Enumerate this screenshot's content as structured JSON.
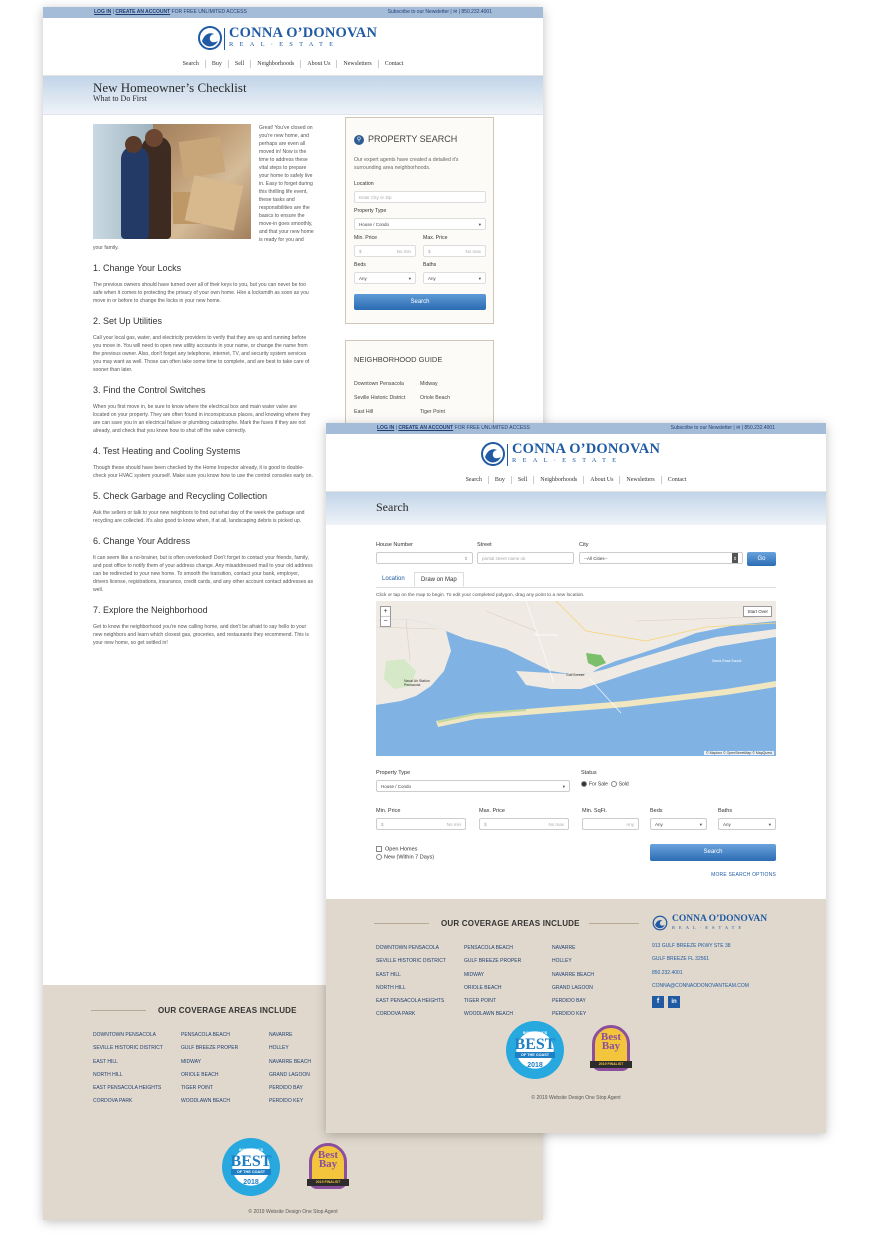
{
  "page1": {
    "topbar": {
      "login": "LOG IN",
      "sep": "|",
      "create": "CREATE AN ACCOUNT",
      "free": "FOR FREE UNLIMITED ACCESS",
      "subscribe": "Subscribe to our Newsletter",
      "phone": "850.232.4001"
    },
    "logo": {
      "name": "CONNA O’DONOVAN",
      "sub": "REAL·ESTATE"
    },
    "nav": [
      "Search",
      "Buy",
      "Sell",
      "Neighborhoods",
      "About Us",
      "Newsletters",
      "Contact"
    ],
    "hero": {
      "title": "New Homeowner’s Checklist",
      "subtitle": "What to Do First"
    },
    "intro": "Great! You've closed on you're new home, and perhaps are even all moved in! Now is the time to address these vital steps to prepare your home to safely live in. Easy to forget during this thrilling life event, these tasks and responsibilities are the basics to ensure the move-in goes smoothly, and that your new home is ready for you and your family.",
    "sections": [
      {
        "heading": "1. Change Your Locks",
        "body": "The previous owners should have turned over all of their keys to you, but you can never be too safe when it comes to protecting the privacy of your own home. Hire a locksmith as soon as you move in or before to change the locks in your new home."
      },
      {
        "heading": "2. Set Up Utilities",
        "body": "Call your local gas, water, and electricity providers to verify that they are up and running before you move in. You will need to open new utility accounts in your name, or change the name from the previous owner. Also, don't forget any telephone, internet, TV, and security system services you may want as well. Those can often take some time to complete, and are best to take care of sooner than later."
      },
      {
        "heading": "3. Find the Control Switches",
        "body": "When you first move in, be sure to know where the electrical box and main water valve are located on your property. They are often found in inconspicuous places, and knowing where they are can save you in an electrical failure or plumbing catastrophe. Mark the fuses if they are not already, and check that you know how to shut off the valve correctly."
      },
      {
        "heading": "4. Test Heating and Cooling Systems",
        "body": "Though these should have been checked by the Home Inspector already, it is good to double-check your HVAC system yourself. Make sure you know how to use the control consoles early on."
      },
      {
        "heading": "5. Check Garbage and Recycling Collection",
        "body": "Ask the sellers or talk to your new neighbors to find out what day of the week the garbage and recycling are collected. It's also good to know when, if at all, landscaping debris is picked up."
      },
      {
        "heading": "6. Change Your Address",
        "body": "It can seem like a no-brainer, but is often overlooked! Don't forget to contact your friends, family, and post office to notify them of your address change. Any misaddressed mail to your old address can be redirected to your new home. To smooth the transition, contact your bank, employer, drivers license, registrations, insurance, credit cards, and any other account contact addresses as well."
      },
      {
        "heading": "7. Explore the Neighborhood",
        "body": "Get to know the neighborhood you're now calling home, and don't be afraid to say hello to your new neighbors and learn which closest gas, groceries, and restaurants they recommend. This is your new home, so get settled in!"
      }
    ],
    "search_box": {
      "title": "PROPERTY SEARCH",
      "desc": "Our expert agents have created a detailed it's surrounding area neighborhoods.",
      "location_label": "Location",
      "location_ph": "Enter City or Zip",
      "type_label": "Property Type",
      "type_value": "House / Condo",
      "min_label": "Min. Price",
      "max_label": "Max. Price",
      "dollar": "$",
      "no_min": "No min",
      "no_max": "No max",
      "beds_label": "Beds",
      "baths_label": "Baths",
      "any": "Any",
      "button": "Search"
    },
    "hood_box": {
      "title": "NEIGHBORHOOD GUIDE",
      "items": [
        "Downtown Pensacola",
        "Midway",
        "Seville Historic District",
        "Oriole Beach",
        "East Hill",
        "Tiger Point"
      ]
    },
    "footer": {
      "title": "OUR COVERAGE AREAS INCLUDE",
      "copyright": "© 2019 Website Design One Stop Agent"
    }
  },
  "coverage": {
    "col1": [
      "DOWNTOWN PENSACOLA",
      "SEVILLE HISTORIC DISTRICT",
      "EAST HILL",
      "NORTH HILL",
      "EAST PENSACOLA HEIGHTS",
      "CORDOVA PARK"
    ],
    "col2": [
      "PENSACOLA BEACH",
      "GULF BREEZE PROPER",
      "MIDWAY",
      "ORIOLE BEACH",
      "TIGER POINT",
      "WOODLAWN BEACH"
    ],
    "col3": [
      "NAVARRE",
      "HOLLEY",
      "NAVARRE BEACH",
      "GRAND LAGOON",
      "PERDIDO BAY",
      "PERDIDO KEY"
    ]
  },
  "badges": {
    "best": {
      "top": "INWEEKLY'S",
      "big": "BEST",
      "ribbon": "OF THE COAST",
      "year": "2018"
    },
    "bay": {
      "year": "2019",
      "big1": "Best",
      "big2": "Bay",
      "ribbon": "2019 FINALIST"
    }
  },
  "page2": {
    "hero": {
      "title": "Search"
    },
    "form": {
      "house_label": "House Number",
      "street_label": "Street",
      "street_ph": "partial street name ok",
      "city_label": "City",
      "city_value": "--All Cities--",
      "go": "Go",
      "tab_location": "Location",
      "tab_map": "Draw on Map",
      "map_hint": "Click or tap on the map to begin. To edit your completed polygon, drag any point to a new location.",
      "start_over": "Start Over",
      "attribution": "© Mapbox © OpenStreetMap © MapQuest",
      "map_labels": [
        "Pensacola Bay",
        "Gulf Breeze",
        "Santa Rosa Sound",
        "Naval Air Station Pensacola"
      ],
      "type_label": "Property Type",
      "type_value": "House / Condo",
      "status_label": "Status",
      "for_sale": "For Sale",
      "sold": "Sold",
      "min_label": "Min. Price",
      "max_label": "Max. Price",
      "sqft_label": "Min. SqFt.",
      "beds_label": "Beds",
      "baths_label": "Baths",
      "dollar": "$",
      "no_min": "No min",
      "no_max": "No max",
      "any": "Any",
      "open_homes": "Open Homes",
      "new7": "New (Within 7 Days)",
      "search": "Search",
      "more": "MORE SEARCH OPTIONS"
    },
    "contact": {
      "addr1": "913 GULF BREEZE PKWY STE 38",
      "addr2": "GULF BREEZE FL 32561",
      "phone": "850.232.4001",
      "email": "CONNA@CONNAODONOVANTEAM.COM",
      "fb": "f",
      "li": "in"
    }
  }
}
